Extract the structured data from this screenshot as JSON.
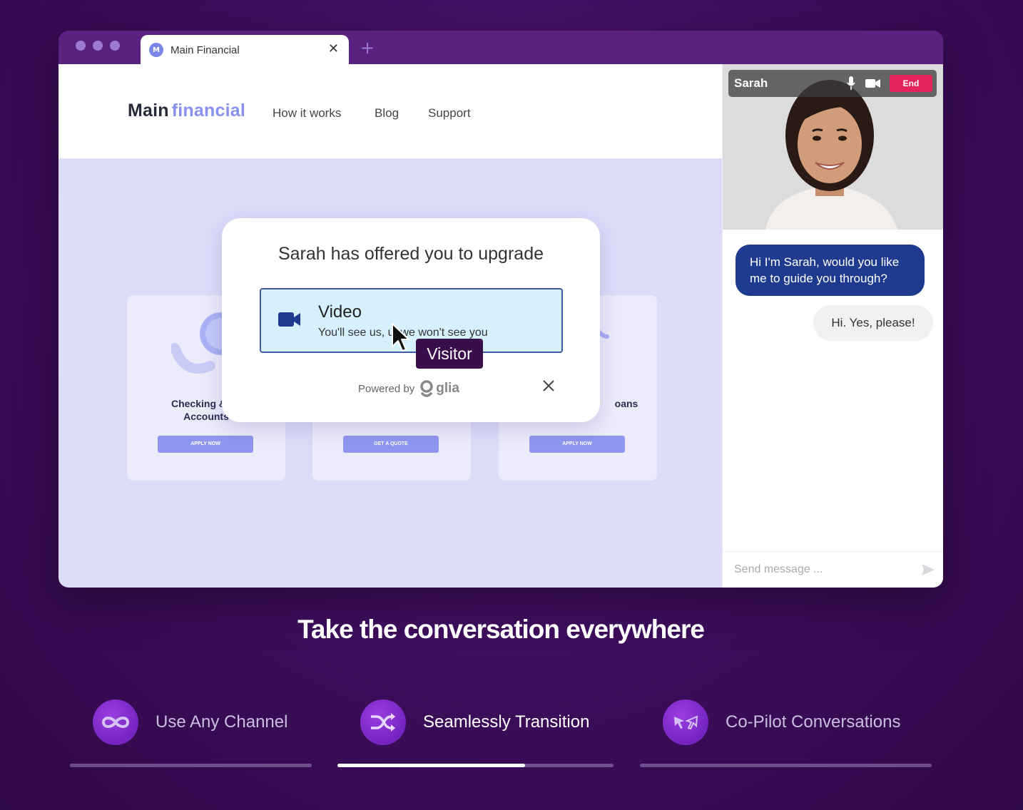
{
  "browser": {
    "tab_title": "Main Financial",
    "tab_favicon_letter": "M",
    "tab_close": "✕",
    "new_tab": "+"
  },
  "site": {
    "logo_main": "Main",
    "logo_accent": "financial",
    "nav": [
      "How it works",
      "Blog",
      "Support"
    ],
    "cards": [
      {
        "title_line1": "Checking & Sa",
        "title_line2": "Accounts",
        "button": "APPLY NOW"
      },
      {
        "title_line1": "",
        "title_line2": "",
        "button": "GET A QUOTE"
      },
      {
        "title_line1": "oans",
        "title_line2": "",
        "button": "APPLY NOW"
      }
    ]
  },
  "modal": {
    "title": "Sarah has offered you to upgrade",
    "option_label": "Video",
    "option_desc_a": "You'll see us,",
    "option_desc_b": "ut we won't see you",
    "powered_by": "Powered by",
    "brand": "glia"
  },
  "cursor_tag": "Visitor",
  "call": {
    "caller": "Sarah",
    "end_label": "End"
  },
  "chat": {
    "agent_message": "Hi I'm Sarah, would you like me to guide you through?",
    "user_message": "Hi. Yes, please!",
    "input_placeholder": "Send message ..."
  },
  "headline": "Take the conversation everywhere",
  "features": [
    {
      "label": "Use Any Channel",
      "icon": "infinity-icon",
      "active": false,
      "progress": 0
    },
    {
      "label": "Seamlessly Transition",
      "icon": "shuffle-icon",
      "active": true,
      "progress": 0.68
    },
    {
      "label": "Co-Pilot Conversations",
      "icon": "dual-cursor-icon",
      "active": false,
      "progress": 0
    }
  ],
  "colors": {
    "background": "#3f0e5e",
    "accent": "#8791ee",
    "agent_bubble": "#1f3b8f",
    "end_button": "#e4245a",
    "feature_circle": "#7424c0"
  }
}
